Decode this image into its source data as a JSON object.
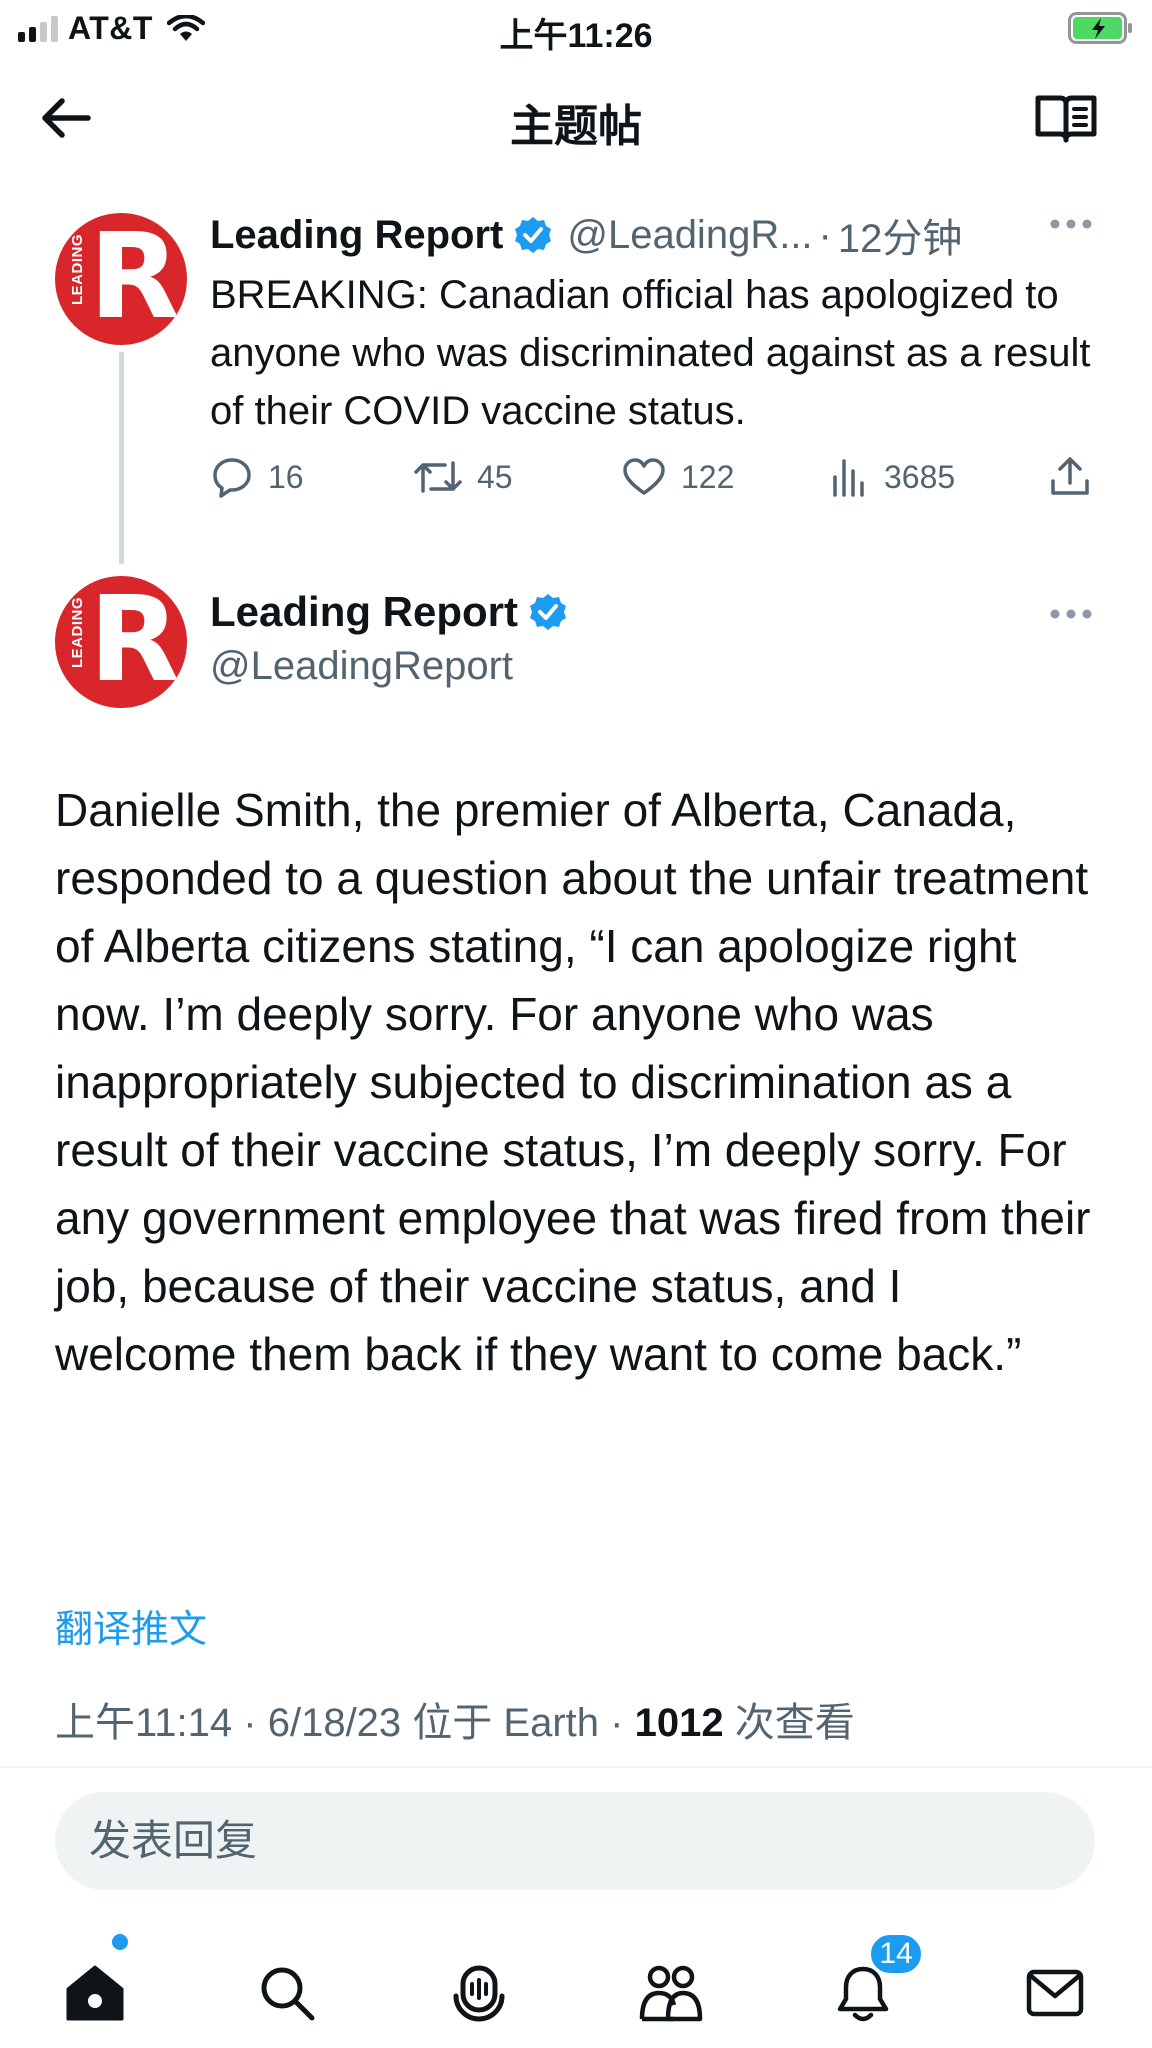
{
  "status_bar": {
    "carrier": "AT&T",
    "time": "上午11:26",
    "icons": [
      "signal-icon",
      "wifi-icon",
      "battery-charging-icon"
    ],
    "battery_color": "#4cd964"
  },
  "header": {
    "title": "主题帖",
    "icons": [
      "back-arrow-icon",
      "reader-mode-icon"
    ]
  },
  "parent_tweet": {
    "author_name": "Leading Report",
    "handle": "@LeadingR...",
    "time_ago": "12分钟",
    "separator": "·",
    "text": "BREAKING: Canadian official has apologized to anyone who was discriminated against as a result of their COVID vaccine status.",
    "replies": "16",
    "retweets": "45",
    "likes": "122",
    "views": "3685"
  },
  "main_tweet": {
    "author_name": "Leading Report",
    "handle": "@LeadingReport",
    "text": "Danielle Smith, the premier of Alberta, Canada, responded to a question about the unfair treatment of Alberta citizens stating, “I can apologize right now. I’m deeply sorry. For anyone who was inappropriately subjected to discrimination as a result of their vaccine status, I’m deeply sorry. For any government employee that was fired from their job, because of their vaccine status, and I welcome them back if they want to come back.”",
    "translate_label": "翻译推文",
    "meta_time": "上午11:14",
    "meta_date": "6/18/23",
    "meta_location": "位于 Earth",
    "view_count": "1012",
    "views_label": "次查看",
    "separator": "·"
  },
  "reply": {
    "placeholder": "发表回复"
  },
  "tab_bar": {
    "tabs": [
      "home-icon",
      "search-icon",
      "spaces-icon",
      "communities-icon",
      "notifications-icon",
      "messages-icon"
    ],
    "notification_badge": "14"
  },
  "colors": {
    "accent": "#1d9bf0",
    "avatar_red": "#d8262b",
    "secondary_text": "#536471"
  }
}
